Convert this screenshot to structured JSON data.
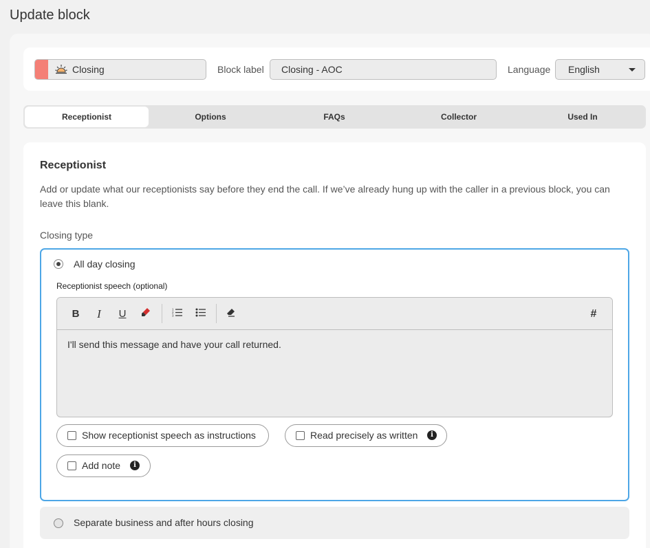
{
  "page": {
    "title": "Update block"
  },
  "header": {
    "block_type": {
      "label": "Closing",
      "icon": "sunset-icon",
      "color": "#f47f76"
    },
    "block_label": {
      "label": "Block label",
      "value": "Closing - AOC"
    },
    "language": {
      "label": "Language",
      "value": "English"
    }
  },
  "tabs": [
    {
      "label": "Receptionist",
      "active": true
    },
    {
      "label": "Options"
    },
    {
      "label": "FAQs"
    },
    {
      "label": "Collector"
    },
    {
      "label": "Used In"
    }
  ],
  "receptionist": {
    "title": "Receptionist",
    "description": "Add or update what our receptionists say before they end the call. If we’ve already hung up with the caller in a previous block, you can leave this blank.",
    "closing_type_label": "Closing type",
    "options": [
      {
        "label": "All day closing",
        "selected": true,
        "speech_label": "Receptionist speech (optional)",
        "toolbar": {
          "bold": "B",
          "italic": "I",
          "underline": "U",
          "highlight_icon": "highlighter-icon",
          "ordered_list_icon": "ordered-list-icon",
          "bullet_list_icon": "bullet-list-icon",
          "clear_format_icon": "eraser-icon",
          "variable": "#"
        },
        "speech_text": "I'll send this message and have your call returned.",
        "checkboxes": {
          "show_as_instructions": {
            "label": "Show receptionist speech as instructions",
            "checked": false
          },
          "read_precisely": {
            "label": "Read precisely as written",
            "checked": false
          },
          "add_note": {
            "label": "Add note",
            "checked": false
          }
        }
      },
      {
        "label": "Separate business and after hours closing",
        "selected": false
      }
    ]
  },
  "colors": {
    "accent_border": "#4da6e6",
    "strip": "#f47f76"
  }
}
